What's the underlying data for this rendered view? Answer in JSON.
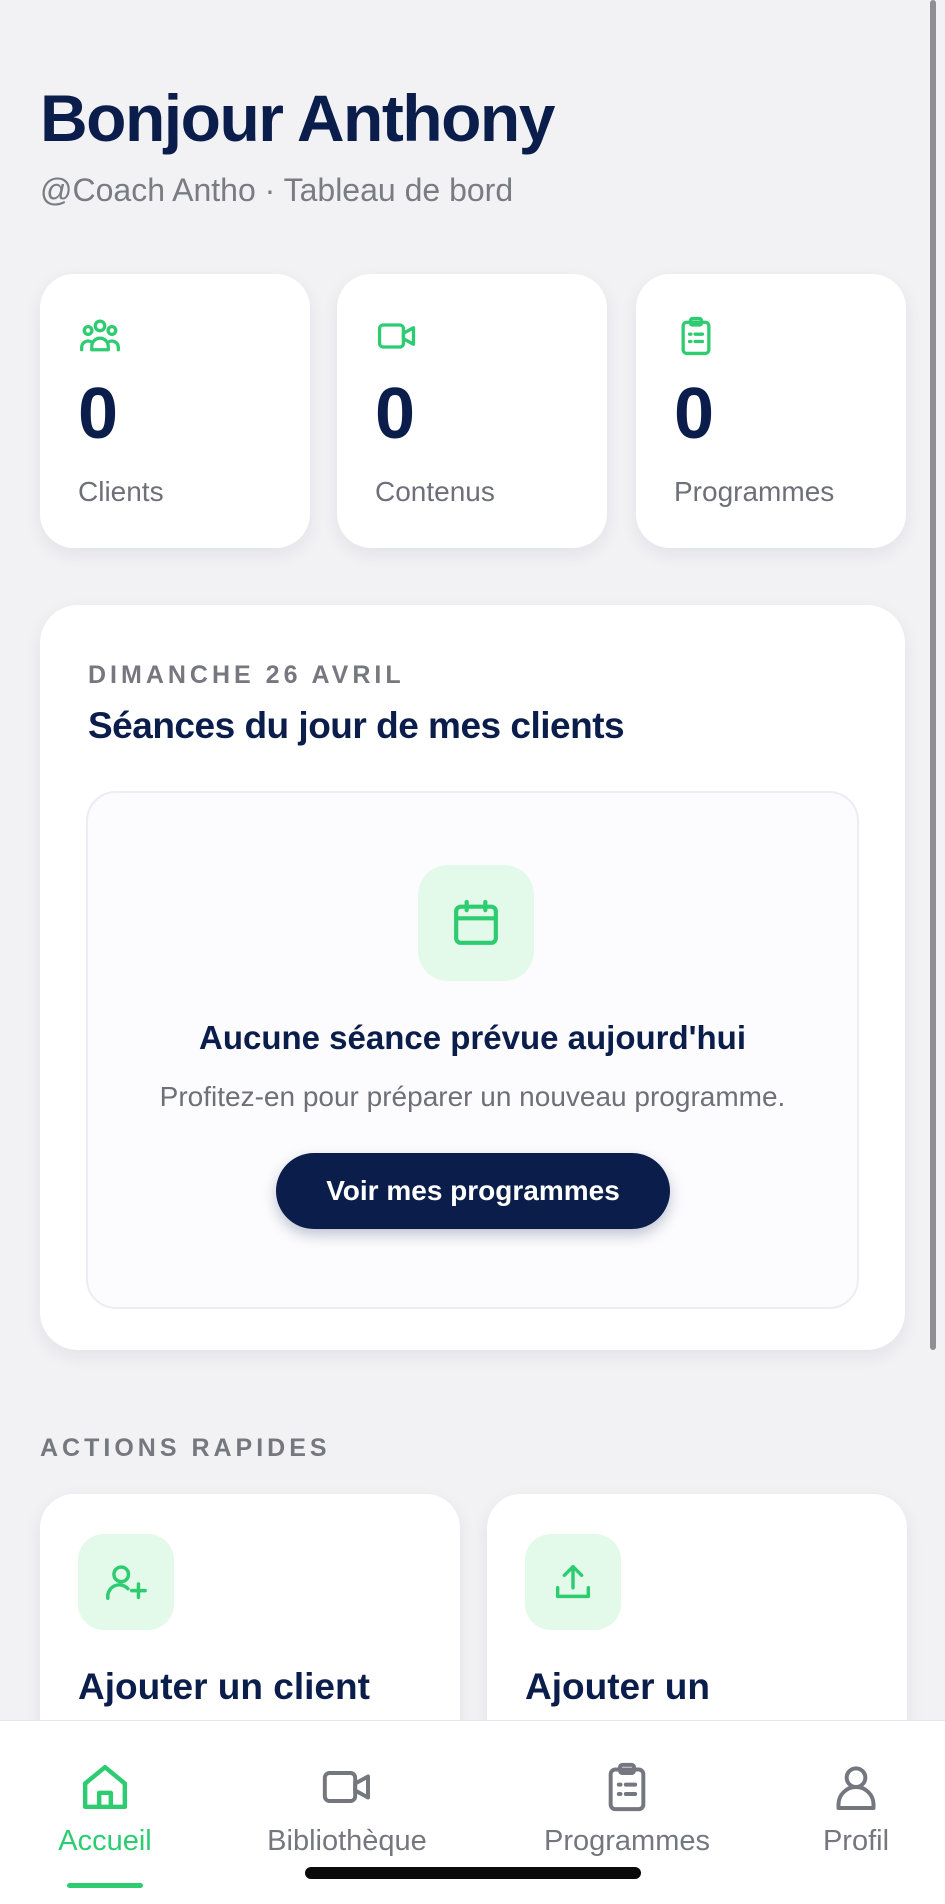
{
  "header": {
    "greeting": "Bonjour Anthony",
    "subtitle": "@Coach Antho · Tableau de bord"
  },
  "stats": [
    {
      "icon": "users-icon",
      "value": "0",
      "label": "Clients"
    },
    {
      "icon": "video-icon",
      "value": "0",
      "label": "Contenus"
    },
    {
      "icon": "clipboard-icon",
      "value": "0",
      "label": "Programmes"
    }
  ],
  "today": {
    "date": "DIMANCHE 26 AVRIL",
    "title": "Séances du jour de mes clients",
    "empty": {
      "icon": "calendar-icon",
      "title": "Aucune séance prévue aujourd'hui",
      "text": "Profitez-en pour préparer un nouveau programme.",
      "button": "Voir mes programmes"
    }
  },
  "quick_actions": {
    "heading": "ACTIONS RAPIDES",
    "items": [
      {
        "icon": "user-plus-icon",
        "title": "Ajouter un client"
      },
      {
        "icon": "upload-icon",
        "title": "Ajouter un"
      }
    ]
  },
  "tabbar": {
    "items": [
      {
        "icon": "home-icon",
        "label": "Accueil",
        "active": true
      },
      {
        "icon": "video-icon",
        "label": "Bibliothèque",
        "active": false
      },
      {
        "icon": "clipboard-icon",
        "label": "Programmes",
        "active": false
      },
      {
        "icon": "user-icon",
        "label": "Profil",
        "active": false
      }
    ]
  },
  "colors": {
    "accent": "#2ecc71",
    "navy": "#0b1d4a",
    "background": "#f2f2f5",
    "muted_text": "#6e7079"
  }
}
